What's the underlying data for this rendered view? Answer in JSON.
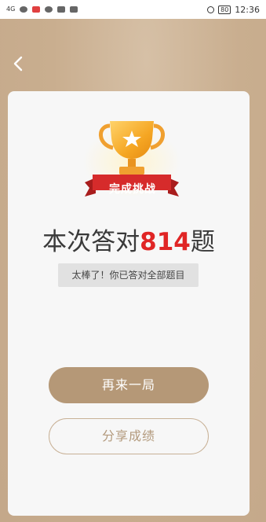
{
  "status_bar": {
    "time": "12:36",
    "battery": "80",
    "signal": "4G"
  },
  "nav": {
    "back_icon": "chevron-left-icon"
  },
  "result": {
    "badge": "完成挑战",
    "prefix": "本次答对",
    "count": "814",
    "suffix": "题",
    "praise": "太棒了！你已答对全部题目"
  },
  "actions": {
    "play_again": "再来一局",
    "share": "分享成绩"
  },
  "colors": {
    "accent": "#b59877",
    "highlight": "#e02525",
    "badge_red": "#d62b2b",
    "trophy_gold": "#f5b43a"
  }
}
